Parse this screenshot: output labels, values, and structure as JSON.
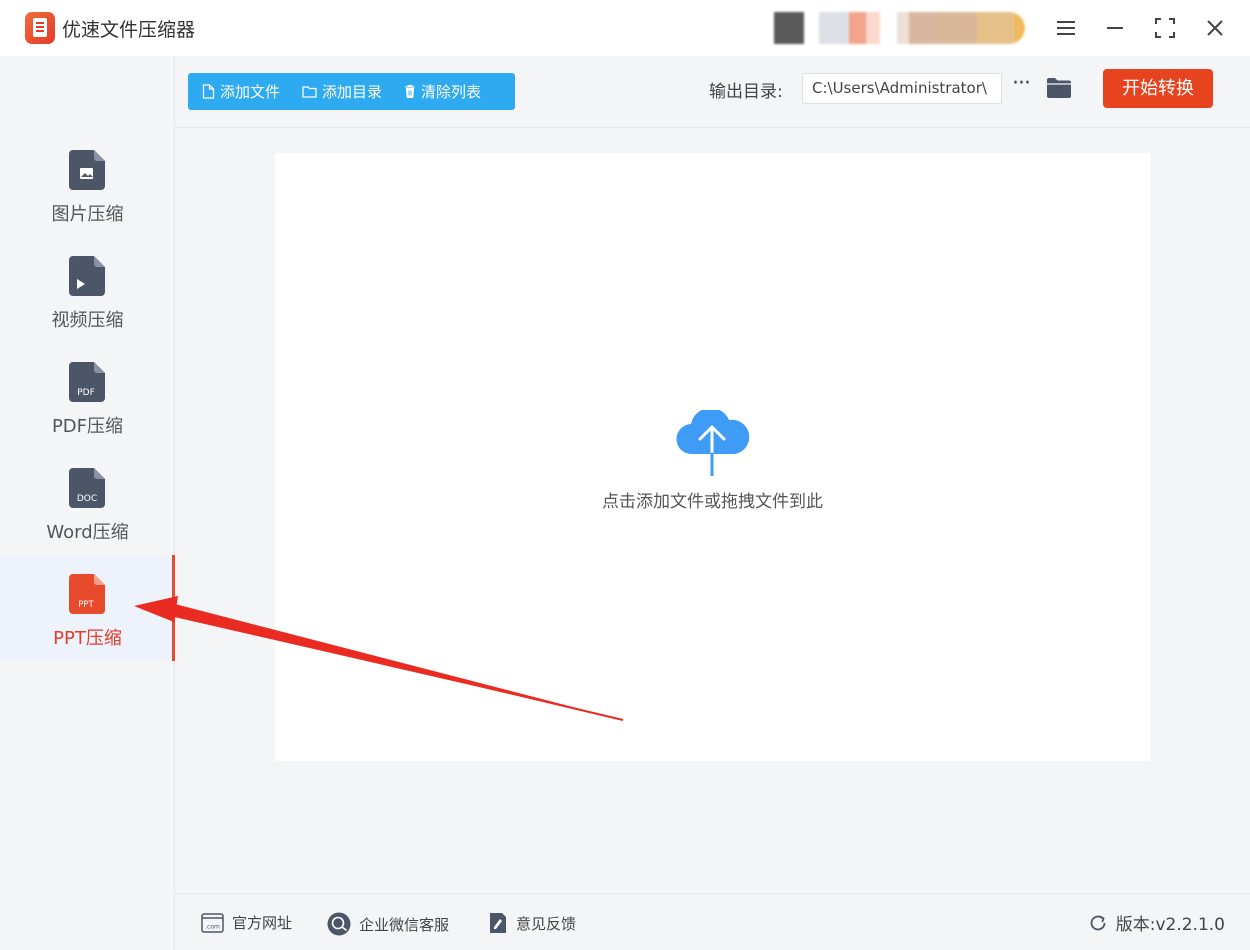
{
  "titlebar": {
    "app_title": "优速文件压缩器",
    "icons": [
      "app-logo",
      "menu-icon",
      "minimize-icon",
      "maximize-icon",
      "close-icon"
    ]
  },
  "sidebar": {
    "items": [
      {
        "label": "图片压缩",
        "icon": "image-file-icon",
        "icon_text": "",
        "active": false
      },
      {
        "label": "视频压缩",
        "icon": "video-file-icon",
        "icon_text": "",
        "active": false
      },
      {
        "label": "PDF压缩",
        "icon": "pdf-file-icon",
        "icon_text": "PDF",
        "active": false
      },
      {
        "label": "Word压缩",
        "icon": "doc-file-icon",
        "icon_text": "DOC",
        "active": false
      },
      {
        "label": "PPT压缩",
        "icon": "ppt-file-icon",
        "icon_text": "PPT",
        "active": true
      }
    ]
  },
  "toolbar": {
    "add_file": "添加文件",
    "add_dir": "添加目录",
    "clear_list": "清除列表",
    "output_label": "输出目录:",
    "output_path": "C:\\Users\\Administrator\\",
    "more": "···",
    "start": "开始转换"
  },
  "drop_area": {
    "hint": "点击添加文件或拖拽文件到此"
  },
  "footer": {
    "website": "官方网址",
    "wechat": "企业微信客服",
    "feedback": "意见反馈",
    "version": "版本:v2.2.1.0"
  },
  "colors": {
    "accent_blue": "#2eaaf0",
    "accent_red": "#e8431f",
    "sidebar_icon": "#4d5668",
    "active_icon": "#e84a2c",
    "cloud": "#3e9bf6"
  }
}
